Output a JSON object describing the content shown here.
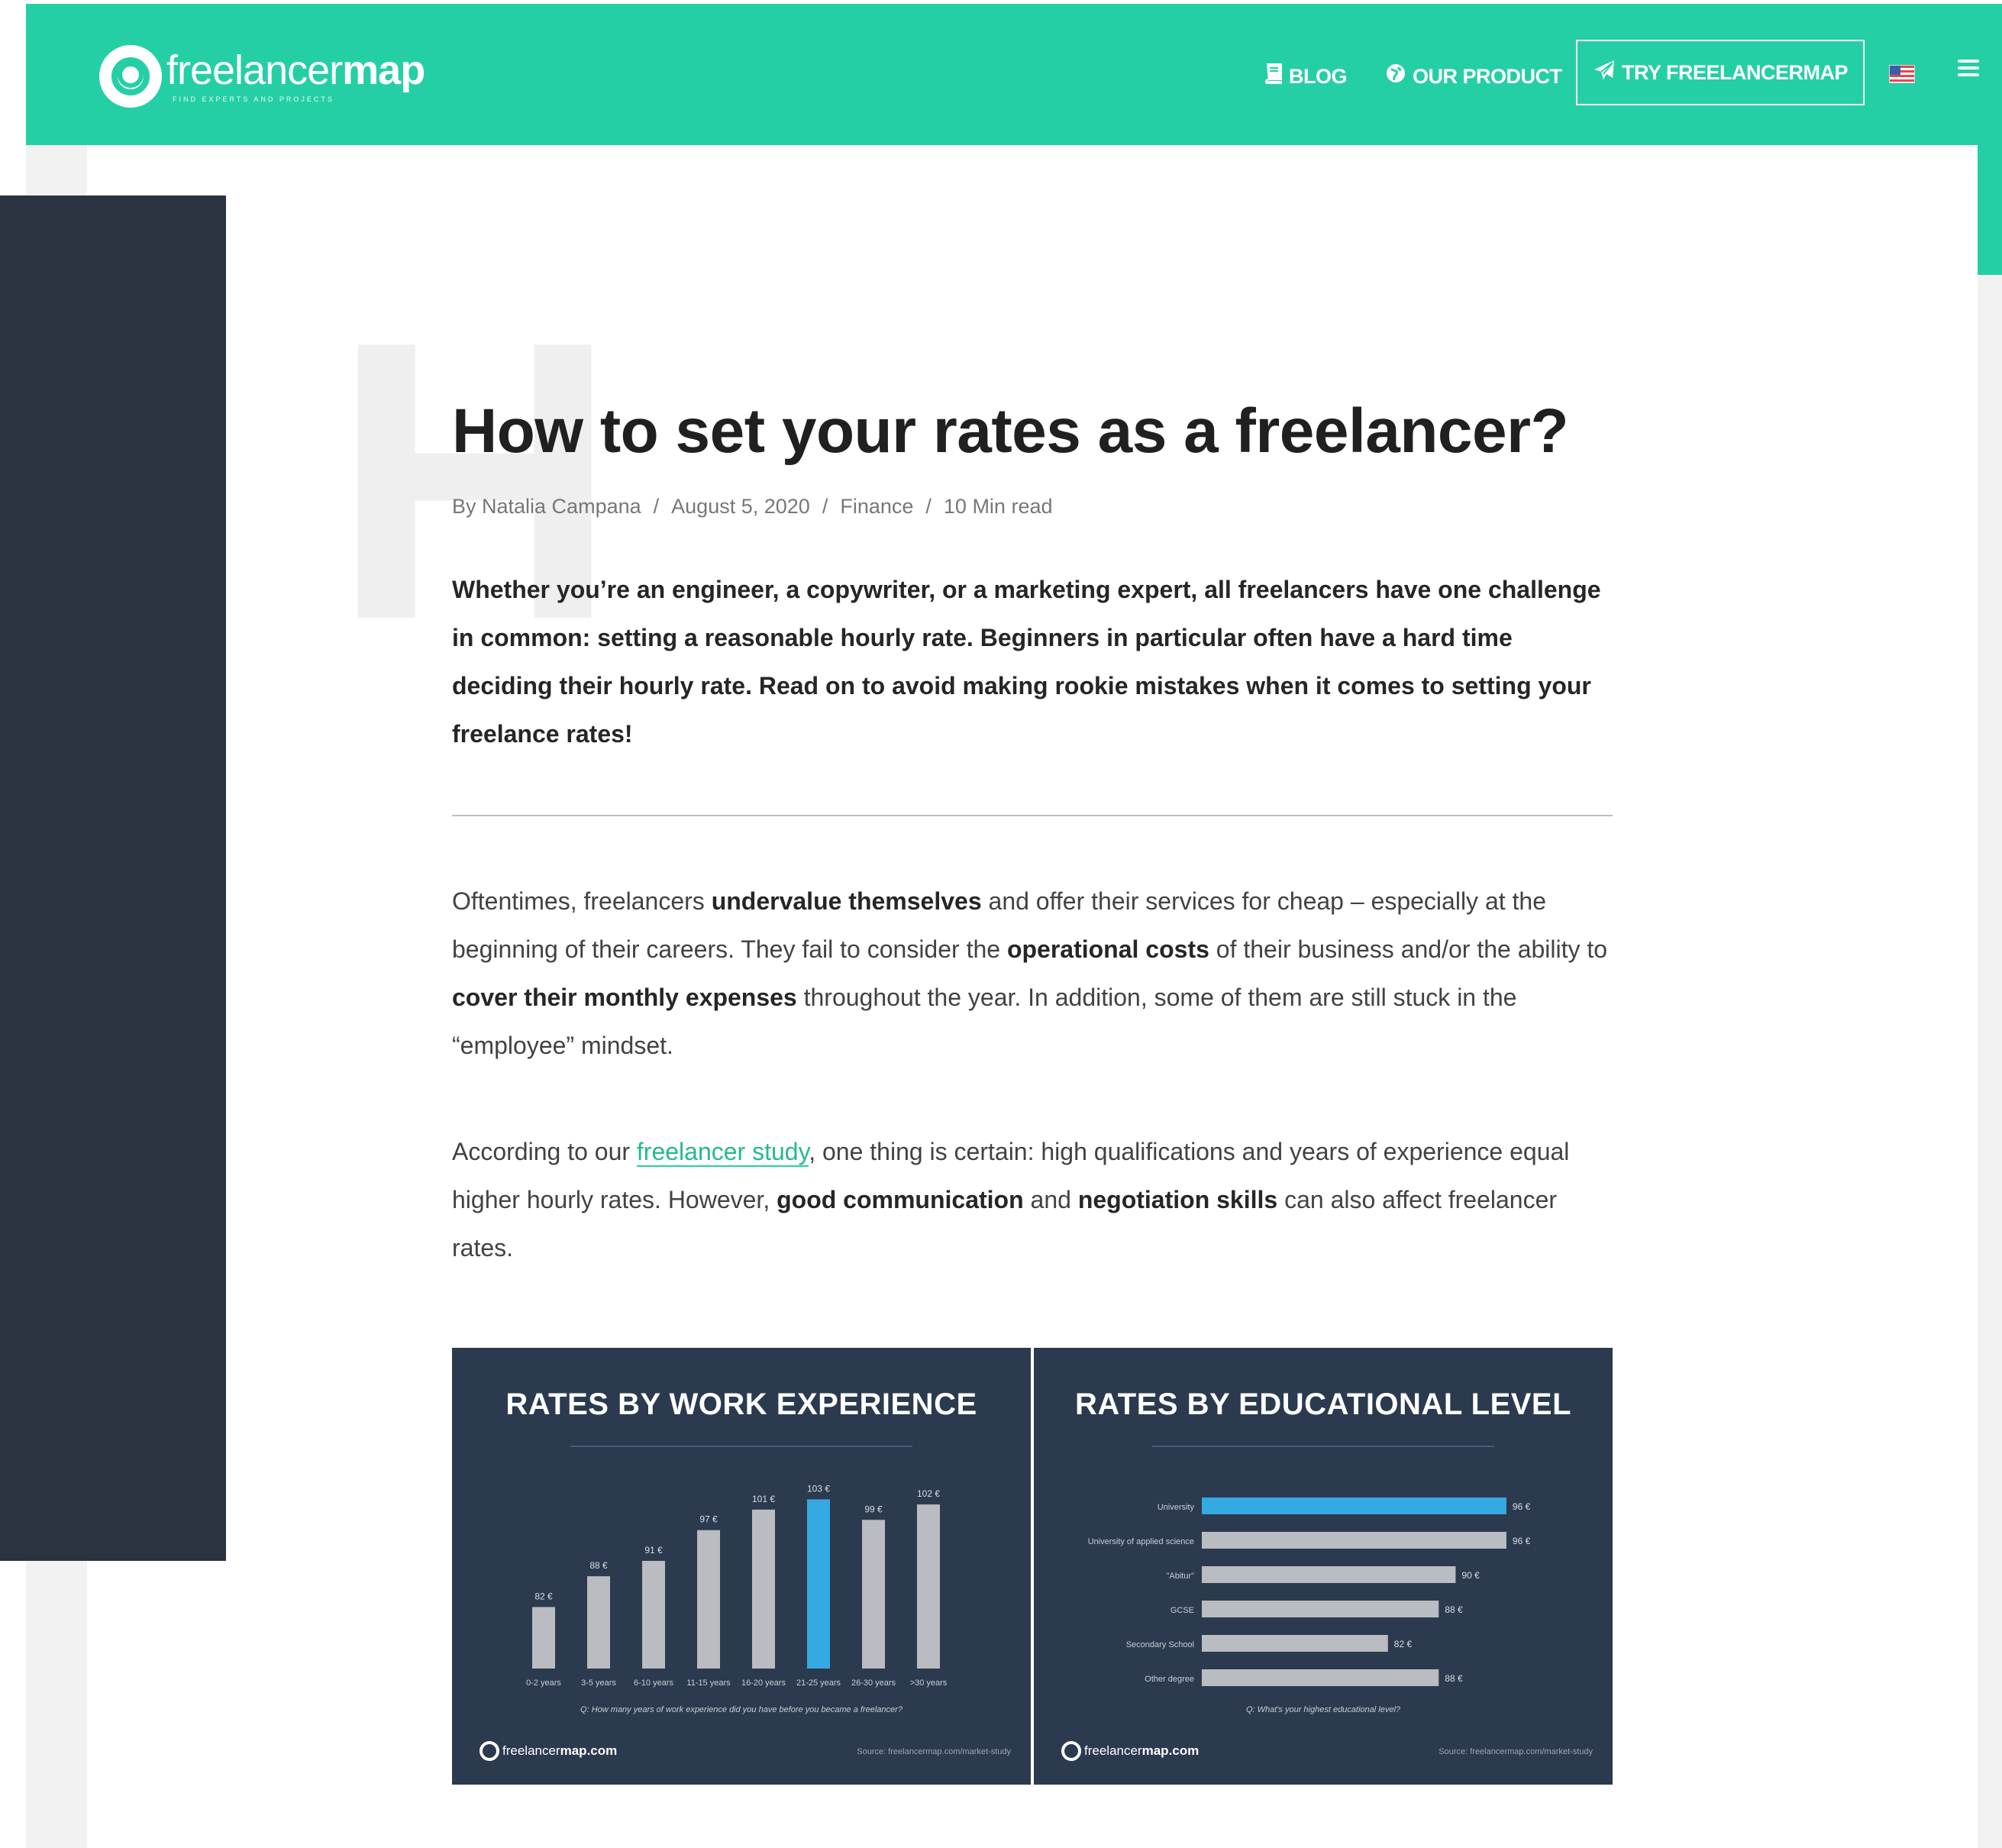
{
  "header": {
    "logo_text_regular": "freelancer",
    "logo_text_bold": "map",
    "logo_tagline": "FIND EXPERTS AND PROJECTS",
    "nav": {
      "blog": "BLOG",
      "product": "OUR PRODUCT",
      "try": "TRY FREELANCERMAP"
    },
    "icons": {
      "blog": "book-icon",
      "product": "globe-icon",
      "try": "rocket-icon",
      "language": "us-flag-icon",
      "menu": "hamburger-menu-icon"
    },
    "accent_color": "#25cfa5"
  },
  "watermark_letter": "H",
  "article": {
    "title": "How to set your rates as a freelancer?",
    "meta": {
      "author": "By Natalia Campana",
      "date": "August 5, 2020",
      "category": "Finance",
      "read_time": "10 Min read",
      "separator": "/"
    },
    "lead": "Whether you’re an engineer, a copywriter, or a marketing expert, all freelancers have one challenge in common: setting a reasonable hourly rate. Beginners in particular often have a hard time deciding their hourly rate. Read on to avoid making rookie mistakes when it comes to setting your freelance rates!",
    "p1": {
      "t1": "Oftentimes, freelancers ",
      "b1": "undervalue themselves",
      "t2": " and offer their services for cheap – especially at the beginning of their careers. They fail to consider the ",
      "b2": "operational costs",
      "t3": " of their business and/or the ability to ",
      "b3": "cover their monthly expenses",
      "t4": " throughout the year. In addition, some of them are still stuck in the “employee” mindset."
    },
    "p2": {
      "t1": "According to our ",
      "link": "freelancer study",
      "t2": ", one thing is certain: high qualifications and years of experience equal higher hourly rates. However, ",
      "b1": "good communication",
      "t3": " and ",
      "b2": "negotiation skills",
      "t4": " can also affect freelancer rates."
    }
  },
  "infographics": {
    "footer_brand_regular": "freelancer",
    "footer_brand_bold": "map.com",
    "source": "Source: freelancermap.com/market-study",
    "bar_color": "#b9bcc0",
    "highlight_color": "#35a9e1",
    "card_color": "#2b3a4e"
  },
  "chart_data": [
    {
      "type": "bar",
      "title": "RATES BY WORK EXPERIENCE",
      "categories": [
        "0-2 years",
        "3-5 years",
        "6-10 years",
        "11-15 years",
        "16-20 years",
        "21-25 years",
        "26-30 years",
        ">30 years"
      ],
      "values": [
        82,
        88,
        91,
        97,
        101,
        103,
        99,
        102
      ],
      "value_labels": [
        "82 €",
        "88 €",
        "91 €",
        "97 €",
        "101 €",
        "103 €",
        "99 €",
        "102 €"
      ],
      "highlight_index": 5,
      "question": "Q: How many years of work experience did you have before you became a freelancer?",
      "ylim": [
        70,
        105
      ],
      "unit": "€"
    },
    {
      "type": "bar",
      "orientation": "horizontal",
      "title": "RATES BY EDUCATIONAL LEVEL",
      "categories": [
        "University",
        "University of applied science",
        "\"Abitur\"",
        "GCSE",
        "Secondary School",
        "Other degree"
      ],
      "values": [
        96,
        96,
        90,
        88,
        82,
        88
      ],
      "value_labels": [
        "96 €",
        "96 €",
        "90 €",
        "88 €",
        "82 €",
        "88 €"
      ],
      "highlight_index": 0,
      "question": "Q: What's your highest educational level?",
      "xlim": [
        60,
        97
      ],
      "unit": "€"
    }
  ]
}
